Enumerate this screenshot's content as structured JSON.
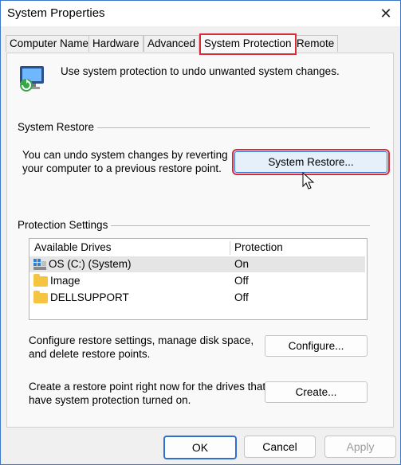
{
  "window": {
    "title": "System Properties",
    "close_glyph": "✕"
  },
  "tabs": [
    {
      "label": "Computer Name"
    },
    {
      "label": "Hardware"
    },
    {
      "label": "Advanced"
    },
    {
      "label": "System Protection"
    },
    {
      "label": "Remote"
    }
  ],
  "intro": {
    "text": "Use system protection to undo unwanted system changes.",
    "icon": "system-protection-icon"
  },
  "system_restore": {
    "group_label": "System Restore",
    "description_line1": "You can undo system changes by reverting",
    "description_line2": "your computer to a previous restore point.",
    "button_label": "System Restore..."
  },
  "protection_settings": {
    "group_label": "Protection Settings",
    "columns": [
      "Available Drives",
      "Protection"
    ],
    "drives": [
      {
        "name": "OS (C:) (System)",
        "protection": "On",
        "icon": "windows-drive-icon"
      },
      {
        "name": "Image",
        "protection": "Off",
        "icon": "folder-icon"
      },
      {
        "name": "DELLSUPPORT",
        "protection": "Off",
        "icon": "folder-icon"
      }
    ],
    "configure_text_line1": "Configure restore settings, manage disk space,",
    "configure_text_line2": "and delete restore points.",
    "configure_button": "Configure...",
    "create_text_line1": "Create a restore point right now for the drives that",
    "create_text_line2": "have system protection turned on.",
    "create_button": "Create..."
  },
  "footer": {
    "ok": "OK",
    "cancel": "Cancel",
    "apply": "Apply"
  },
  "colors": {
    "highlight": "#d62b3b",
    "accent": "#2f6fd0",
    "folder": "#f5c542"
  }
}
